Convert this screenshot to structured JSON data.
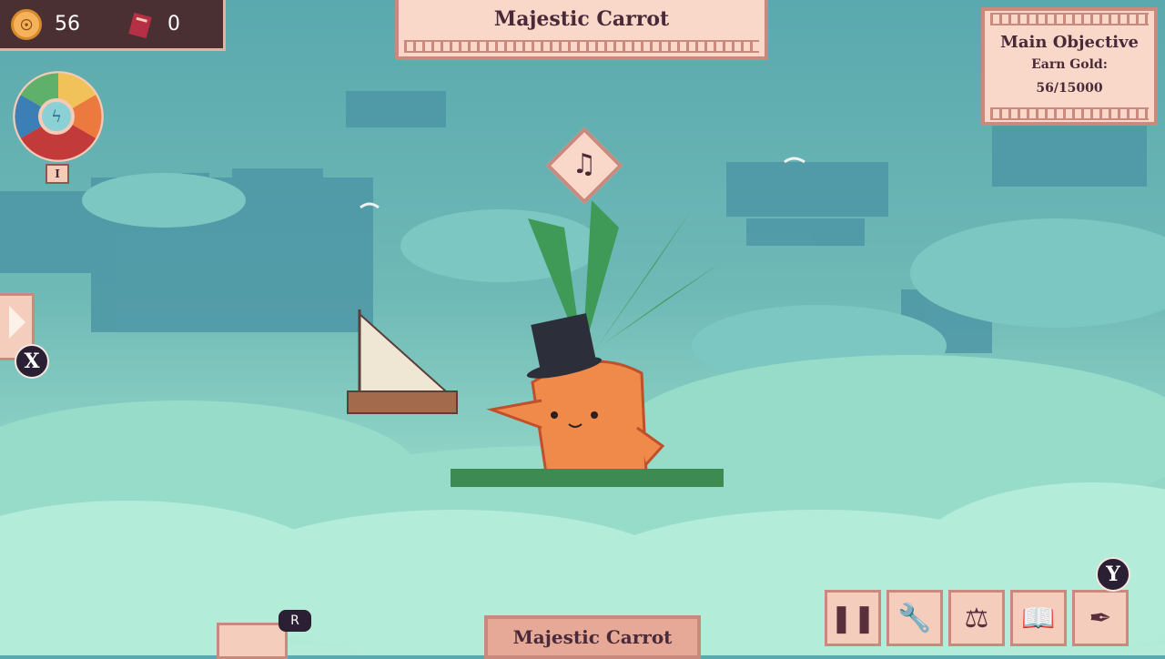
{
  "resources": {
    "gold_icon": "coin-icon",
    "gold": "56",
    "tickets_icon": "ticket-icon",
    "tickets": "0"
  },
  "top_banner": {
    "title": "Majestic Carrot"
  },
  "objective": {
    "title": "Main Objective",
    "subtitle": "Earn Gold:",
    "progress": "56/15000"
  },
  "element_wheel": {
    "hotkey": "I"
  },
  "buttons": {
    "x_label": "X",
    "y_label": "Y",
    "r_label": "R"
  },
  "bottom_banner": {
    "title": "Majestic Carrot"
  },
  "toolbar": [
    "pause-icon",
    "wrench-icon",
    "scales-icon",
    "book-icon",
    "quill-icon"
  ],
  "colors": {
    "panel": "#f9d8c9",
    "panel_border": "#c98a7d",
    "text": "#4a2a38",
    "sky": "#5aa9ae"
  }
}
